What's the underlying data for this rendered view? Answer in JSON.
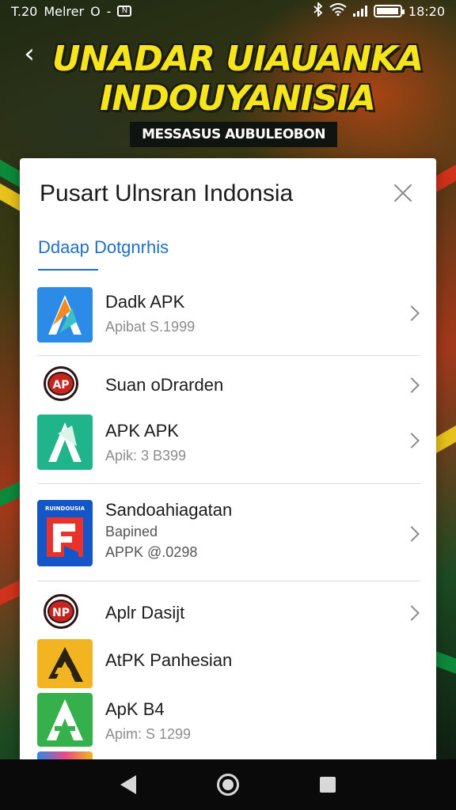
{
  "status_bar": {
    "time_left": "T.20",
    "carrier": "Melrer",
    "indicator_o": "O",
    "indicator_dash": "-",
    "indicator_box": "N",
    "time_right": "18:20",
    "battery_fraction": 0.85
  },
  "banner": {
    "title": "UNADAR UIAUANKA INDOUYANISIA",
    "subtitle": "MESSASUS AUBULEOBON"
  },
  "dialog": {
    "title": "Pusart Ulnsran Indonsia",
    "tab": "Ddaap Dotgnrhis",
    "items": [
      {
        "name": "Dadk APK",
        "sub": "Apibat S.1999",
        "icon": "apk-a-icon",
        "color": "#2b8be6"
      },
      {
        "name": "Suan oDrarden",
        "sub": "",
        "icon": "ap-badge-icon",
        "badge": "AP"
      },
      {
        "name": "APK APK",
        "sub": "Apik: 3 B399",
        "icon": "apk-a-icon",
        "color": "#1fb489"
      },
      {
        "name": "Sandoahiagatan",
        "sub": "Bapined",
        "sub2": "APPK @.0298",
        "icon": "f-box-icon",
        "color": "#1456c8",
        "caption": "RUINDOUSIA"
      },
      {
        "name": "Aplr Dasijt",
        "sub": "",
        "icon": "np-badge-icon",
        "badge": "NP"
      },
      {
        "name": "AtPK Panhesian",
        "sub": "",
        "icon": "apk-a-icon",
        "color": "#f2b420"
      },
      {
        "name": "ApK B4",
        "sub": "Apim: S 1299",
        "icon": "apk-a-icon",
        "color": "#35b04a"
      }
    ]
  },
  "nav": {
    "back": "back-icon",
    "home": "home-icon",
    "recents": "recents-icon"
  }
}
